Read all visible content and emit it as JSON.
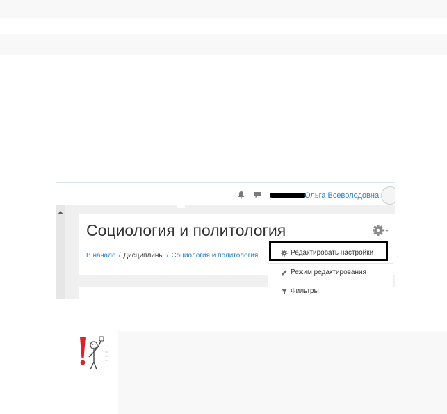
{
  "screenshot": {
    "navbar": {
      "icons": [
        "bell-icon",
        "message-icon"
      ],
      "user_name": "Ольга Всеволодовна"
    },
    "header": {
      "course_title": "Социология и политология",
      "breadcrumb": [
        "В начало",
        "Дисциплины",
        "Социология и политология"
      ],
      "breadcrumb_separator": "/"
    },
    "settings_menu": {
      "items": [
        {
          "icon": "gear-icon",
          "label": "Редактировать настройки",
          "highlighted": true
        },
        {
          "icon": "pencil-icon",
          "label": "Режим редактирования"
        },
        {
          "icon": "filter-icon",
          "label": "Фильтры"
        }
      ]
    }
  },
  "colors": {
    "link": "#2f80c8",
    "title": "#333333",
    "highlight_border": "#000000",
    "warning": "#d9242b"
  }
}
